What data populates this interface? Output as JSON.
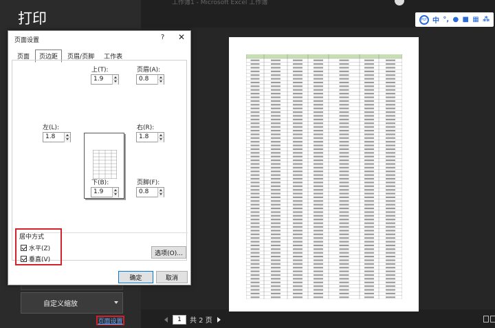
{
  "backstage": {
    "title": "打印",
    "window_caption": "工作簿1 - Microsoft Excel 工作簿",
    "scaling_button": "自定义缩放",
    "page_setup_link": "页面设置"
  },
  "ime_toolbar": {
    "logo": "PLY",
    "lang": "中",
    "items": [
      "°,",
      "🎤",
      "👤",
      "▦",
      "⁂"
    ]
  },
  "pager": {
    "current_page": "1",
    "total_label": "共 2 页"
  },
  "dialog": {
    "title": "页面设置",
    "help": "?",
    "close": "✕",
    "tabs": [
      "页面",
      "页边距",
      "页眉/页脚",
      "工作表"
    ],
    "active_tab": "页边距",
    "top_label": "上(T):",
    "top_value": "1.9",
    "header_label": "页眉(A):",
    "header_value": "0.8",
    "left_label": "左(L):",
    "left_value": "1.8",
    "right_label": "右(R):",
    "right_value": "1.8",
    "bottom_label": "下(B):",
    "bottom_value": "1.9",
    "footer_label": "页脚(F):",
    "footer_value": "0.8",
    "center_group_title": "居中方式",
    "horizontal_label": "水平(Z)",
    "vertical_label": "垂直(V)",
    "options_button": "选项(O)...",
    "ok_button": "确定",
    "cancel_button": "取消"
  },
  "sheet_preview": {
    "headers": [
      "序号",
      "姓名",
      "性别",
      "年龄",
      "部门",
      "职级",
      "入职时间"
    ],
    "header_color": "#c6e0b4",
    "row_count": 65
  },
  "colors": {
    "highlight": "#d0222a",
    "link": "#6aa7ff",
    "ime_blue": "#2a6ad4"
  }
}
